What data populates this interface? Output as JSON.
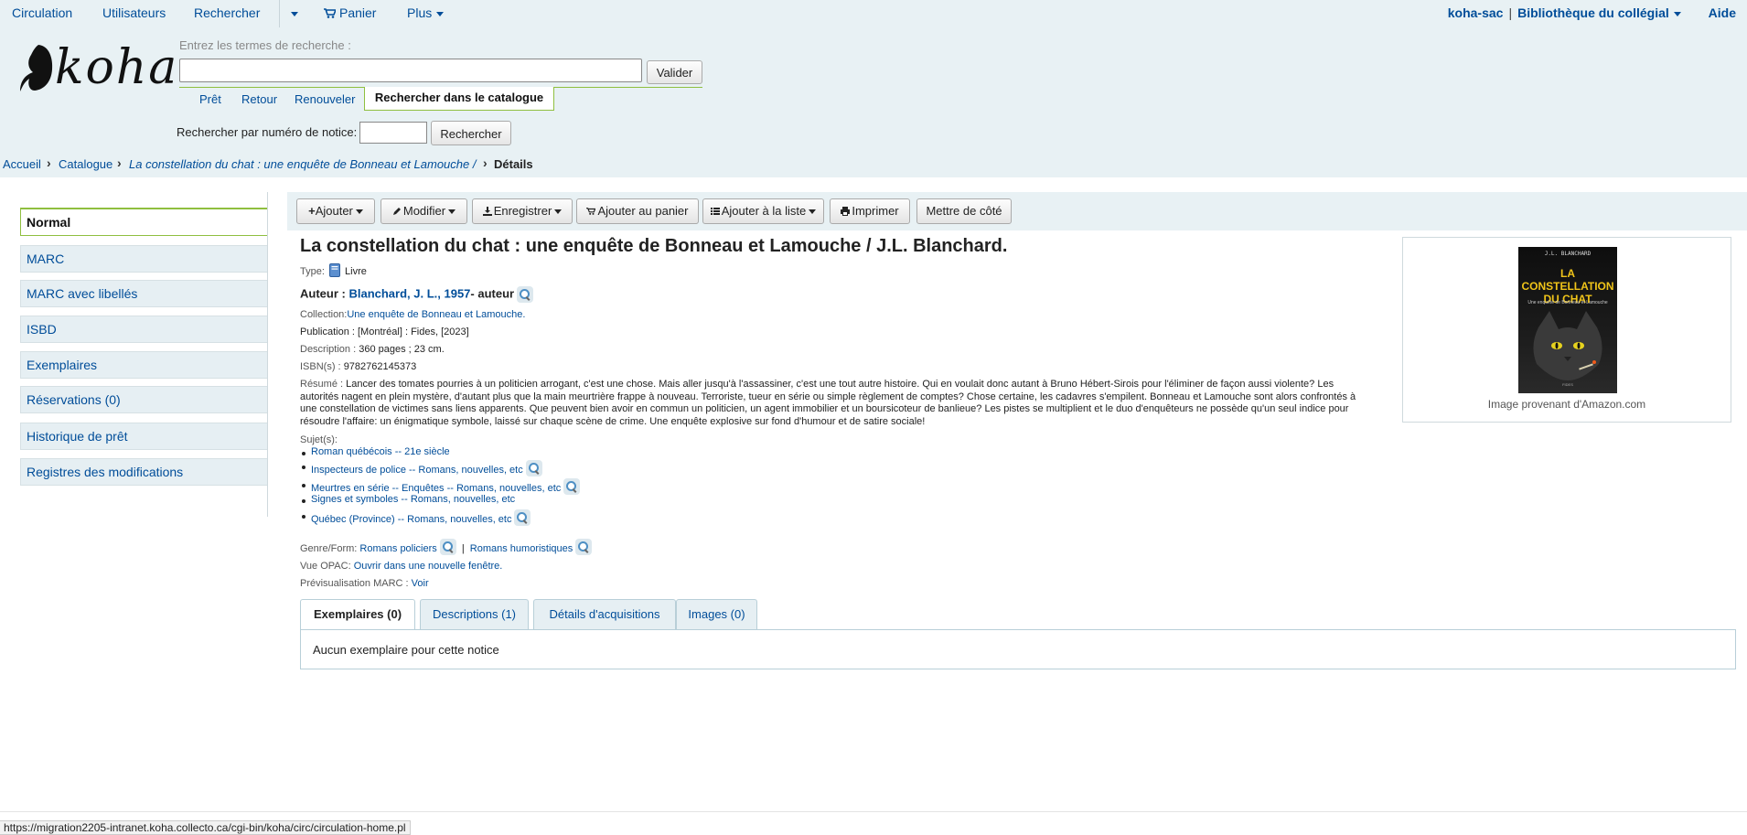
{
  "topnav": {
    "circulation": "Circulation",
    "users": "Utilisateurs",
    "search": "Rechercher",
    "cart": "Panier",
    "more": "Plus",
    "account": "koha-sac",
    "library": "Bibliothèque du collégial",
    "help": "Aide"
  },
  "logo_text": "koha",
  "search": {
    "label": "Entrez les termes de recherche :",
    "value": "",
    "submit": "Valider",
    "tabs": [
      "Prêt",
      "Retour",
      "Renouveler"
    ],
    "active_tab": "Rechercher dans le catalogue",
    "record_label": "Rechercher par numéro de notice:",
    "record_value": "",
    "record_button": "Rechercher"
  },
  "breadcrumb": {
    "home": "Accueil",
    "catalog": "Catalogue",
    "record": "La constellation du chat : une enquête de Bonneau et Lamouche /",
    "current": "Détails"
  },
  "leftnav": [
    "Normal",
    "MARC",
    "MARC avec libellés",
    "ISBD",
    "Exemplaires",
    "Réservations (0)",
    "Historique de prêt",
    "Registres des modifications"
  ],
  "toolbar": {
    "add": "Ajouter",
    "edit": "Modifier",
    "save": "Enregistrer",
    "cart": "Ajouter au panier",
    "list": "Ajouter à la liste",
    "print": "Imprimer",
    "hold": "Mettre de côté"
  },
  "record": {
    "title": "La constellation du chat : une enquête de Bonneau et Lamouche / J.L. Blanchard.",
    "type_label": "Type:",
    "type_value": "Livre",
    "author_label": "Auteur :",
    "author_link": "Blanchard, J. L., 1957",
    "author_role": "- auteur",
    "collection_label": "Collection:",
    "collection_value": "Une enquête de Bonneau et Lamouche.",
    "publication_label": "Publication :",
    "publication_value": "[Montréal] : Fides, [2023]",
    "description_label": "Description :",
    "description_value": "360 pages ; 23 cm.",
    "isbn_label": "ISBN(s) :",
    "isbn_value": "9782762145373",
    "summary_label": "Résumé :",
    "summary_value": "Lancer des tomates pourries à un politicien arrogant, c'est une chose. Mais aller jusqu'à l'assassiner, c'est une tout autre histoire. Qui en voulait donc autant à Bruno Hébert-Sirois pour l'éliminer de façon aussi violente? Les autorités nagent en plein mystère, d'autant plus que la main meurtrière frappe à nouveau. Terroriste, tueur en série ou simple règlement de comptes? Chose certaine, les cadavres s'empilent. Bonneau et Lamouche sont alors confrontés à une constellation de victimes sans liens apparents. Que peuvent bien avoir en commun un politicien, un agent immobilier et un boursicoteur de banlieue? Les pistes se multiplient et le duo d'enquêteurs ne possède qu'un seul indice pour résoudre l'affaire: un énigmatique symbole, laissé sur chaque scène de crime. Une enquête explosive sur fond d'humour et de satire sociale!",
    "subjects_label": "Sujet(s):",
    "subjects": [
      "Roman québécois -- 21e siècle",
      "Inspecteurs de police -- Romans, nouvelles, etc",
      "Meurtres en série -- Enquêtes -- Romans, nouvelles, etc",
      "Signes et symboles -- Romans, nouvelles, etc",
      "Québec (Province) -- Romans, nouvelles, etc"
    ],
    "genre_label": "Genre/Form:",
    "genre_1": "Romans policiers",
    "genre_2": "Romans humoristiques",
    "opac_label": "Vue OPAC:",
    "opac_link": "Ouvrir dans une nouvelle fenêtre.",
    "marc_label": "Prévisualisation MARC :",
    "marc_link": "Voir"
  },
  "cover": {
    "author": "J.L. BLANCHARD",
    "title": "LA CONSTELLATION DU CHAT",
    "subtitle": "Une enquête de Bonneau et Lamouche",
    "publisher": "FIDES",
    "caption": "Image provenant d'Amazon.com"
  },
  "tabs": [
    "Exemplaires (0)",
    "Descriptions (1)",
    "Détails d'acquisitions",
    "Images (0)"
  ],
  "tab_content": "Aucun exemplaire pour cette notice",
  "status_url": "https://migration2205-intranet.koha.collecto.ca/cgi-bin/koha/circ/circulation-home.pl"
}
